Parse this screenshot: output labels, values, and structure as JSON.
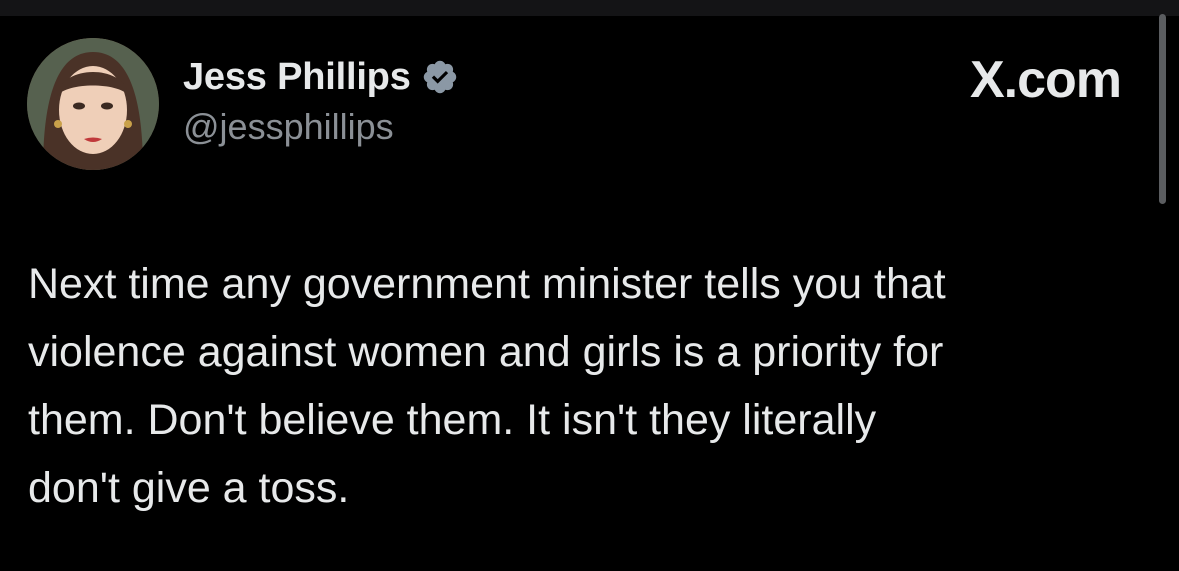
{
  "tweet": {
    "author": {
      "display_name": "Jess Phillips",
      "handle": "@jessphillips",
      "verified_icon": "verified-badge-icon",
      "badge_color": "#8b98a5"
    },
    "brand_label": "X.com",
    "text": "Next time any government minister tells you that\nviolence against women and girls is a priority for\nthem. Don't believe them. It isn't they literally\ndon't give a toss."
  },
  "colors": {
    "background": "#000000",
    "text": "#e7e9ea",
    "secondary_text": "#8b9096"
  }
}
